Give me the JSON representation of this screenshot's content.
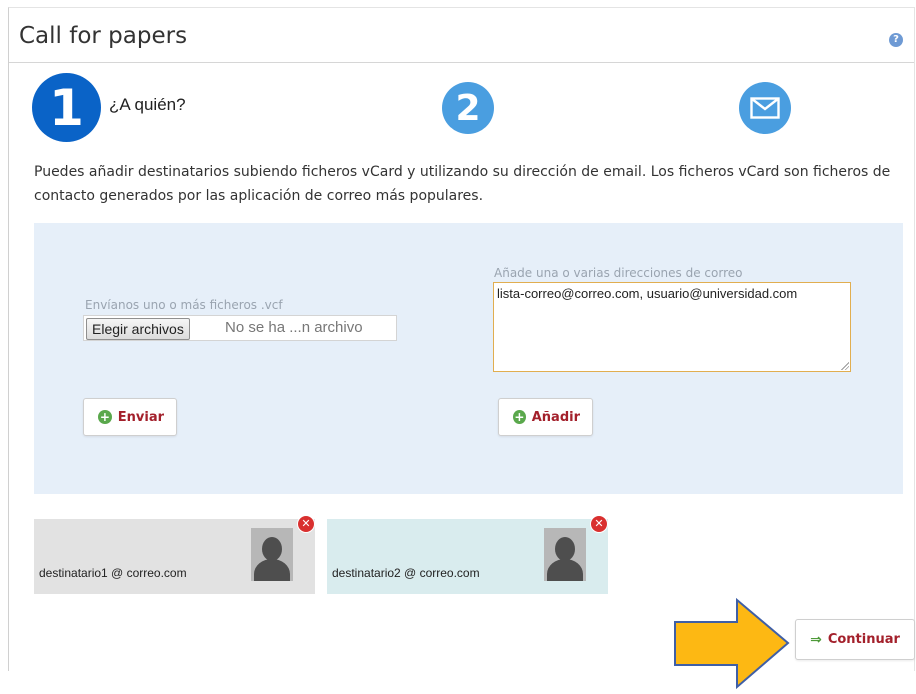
{
  "header": {
    "title": "Call for papers",
    "help_icon": "help-icon",
    "help_glyph": "?"
  },
  "steps": [
    {
      "number": "1",
      "label": "¿A quién?",
      "active": true,
      "color": "#0a63c7"
    },
    {
      "number": "2",
      "active": false,
      "color": "#4a9ee0"
    },
    {
      "icon": "envelope-icon",
      "active": false,
      "color": "#4a9ee0"
    }
  ],
  "intro": "Puedes añadir destinatarios subiendo ficheros vCard y utilizando su dirección de email. Los ficheros vCard son ficheros de contacto generados por las aplicación de correo más populares.",
  "vcf_upload": {
    "label": "Envíanos uno o más ficheros .vcf",
    "choose_button": "Elegir archivos",
    "status": "No se ha ...n archivo",
    "send_button": "Enviar"
  },
  "email_entry": {
    "label": "Añade una o varias direcciones de correo",
    "value": "lista-correo@correo.com, usuario@universidad.com",
    "add_button": "Añadir"
  },
  "recipients": [
    {
      "email": "destinatario1 @ correo.com",
      "background": "#e2e2e2"
    },
    {
      "email": "destinatario2 @ correo.com",
      "background": "#d9ecee"
    }
  ],
  "continue_button": "Continuar",
  "colors": {
    "accent_red": "#a3202b",
    "plus_green": "#5aa84c",
    "highlight_arrow": "#fdb813"
  }
}
